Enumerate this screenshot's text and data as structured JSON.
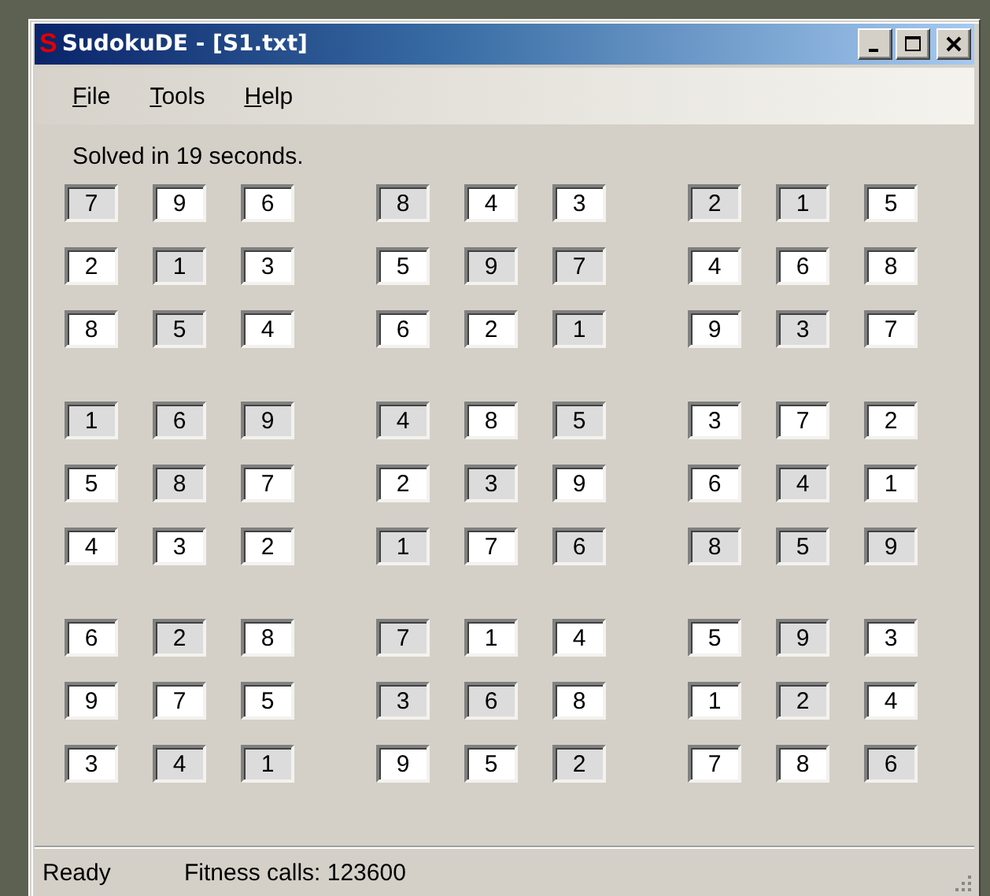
{
  "window": {
    "icon_letter": "S",
    "title": "SudokuDE - [S1.txt]"
  },
  "menu": [
    {
      "label": "File"
    },
    {
      "label": "Tools"
    },
    {
      "label": "Help"
    }
  ],
  "message": "Solved in 19 seconds.",
  "grid": {
    "rows": [
      [
        {
          "value": "7",
          "given": true
        },
        {
          "value": "9",
          "given": false
        },
        {
          "value": "6",
          "given": false
        },
        {
          "value": "8",
          "given": true
        },
        {
          "value": "4",
          "given": false
        },
        {
          "value": "3",
          "given": false
        },
        {
          "value": "2",
          "given": true
        },
        {
          "value": "1",
          "given": true
        },
        {
          "value": "5",
          "given": false
        }
      ],
      [
        {
          "value": "2",
          "given": false
        },
        {
          "value": "1",
          "given": true
        },
        {
          "value": "3",
          "given": false
        },
        {
          "value": "5",
          "given": false
        },
        {
          "value": "9",
          "given": true
        },
        {
          "value": "7",
          "given": true
        },
        {
          "value": "4",
          "given": false
        },
        {
          "value": "6",
          "given": false
        },
        {
          "value": "8",
          "given": false
        }
      ],
      [
        {
          "value": "8",
          "given": false
        },
        {
          "value": "5",
          "given": true
        },
        {
          "value": "4",
          "given": false
        },
        {
          "value": "6",
          "given": false
        },
        {
          "value": "2",
          "given": false
        },
        {
          "value": "1",
          "given": true
        },
        {
          "value": "9",
          "given": false
        },
        {
          "value": "3",
          "given": true
        },
        {
          "value": "7",
          "given": false
        }
      ],
      [
        {
          "value": "1",
          "given": true
        },
        {
          "value": "6",
          "given": true
        },
        {
          "value": "9",
          "given": true
        },
        {
          "value": "4",
          "given": true
        },
        {
          "value": "8",
          "given": false
        },
        {
          "value": "5",
          "given": true
        },
        {
          "value": "3",
          "given": false
        },
        {
          "value": "7",
          "given": false
        },
        {
          "value": "2",
          "given": false
        }
      ],
      [
        {
          "value": "5",
          "given": false
        },
        {
          "value": "8",
          "given": true
        },
        {
          "value": "7",
          "given": false
        },
        {
          "value": "2",
          "given": false
        },
        {
          "value": "3",
          "given": true
        },
        {
          "value": "9",
          "given": false
        },
        {
          "value": "6",
          "given": false
        },
        {
          "value": "4",
          "given": true
        },
        {
          "value": "1",
          "given": false
        }
      ],
      [
        {
          "value": "4",
          "given": false
        },
        {
          "value": "3",
          "given": false
        },
        {
          "value": "2",
          "given": false
        },
        {
          "value": "1",
          "given": true
        },
        {
          "value": "7",
          "given": false
        },
        {
          "value": "6",
          "given": true
        },
        {
          "value": "8",
          "given": true
        },
        {
          "value": "5",
          "given": true
        },
        {
          "value": "9",
          "given": true
        }
      ],
      [
        {
          "value": "6",
          "given": false
        },
        {
          "value": "2",
          "given": true
        },
        {
          "value": "8",
          "given": false
        },
        {
          "value": "7",
          "given": true
        },
        {
          "value": "1",
          "given": false
        },
        {
          "value": "4",
          "given": false
        },
        {
          "value": "5",
          "given": false
        },
        {
          "value": "9",
          "given": true
        },
        {
          "value": "3",
          "given": false
        }
      ],
      [
        {
          "value": "9",
          "given": false
        },
        {
          "value": "7",
          "given": false
        },
        {
          "value": "5",
          "given": false
        },
        {
          "value": "3",
          "given": true
        },
        {
          "value": "6",
          "given": true
        },
        {
          "value": "8",
          "given": false
        },
        {
          "value": "1",
          "given": false
        },
        {
          "value": "2",
          "given": true
        },
        {
          "value": "4",
          "given": false
        }
      ],
      [
        {
          "value": "3",
          "given": false
        },
        {
          "value": "4",
          "given": true
        },
        {
          "value": "1",
          "given": true
        },
        {
          "value": "9",
          "given": false
        },
        {
          "value": "5",
          "given": false
        },
        {
          "value": "2",
          "given": true
        },
        {
          "value": "7",
          "given": false
        },
        {
          "value": "8",
          "given": false
        },
        {
          "value": "6",
          "given": true
        }
      ]
    ]
  },
  "status_bar": {
    "state": "Ready",
    "fitness": "Fitness calls: 123600"
  }
}
